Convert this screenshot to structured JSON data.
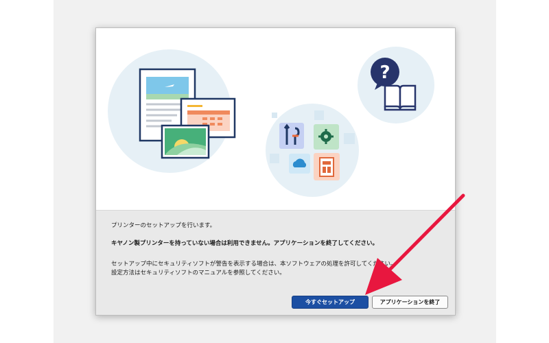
{
  "dialog": {
    "messages": {
      "setup_notice": "プリンターのセットアップを行います。",
      "canon_requirement": "キヤノン製プリンターを持っていない場合は利用できません。アプリケーションを終了してください。",
      "security_line1": "セットアップ中にセキュリティソフトが警告を表示する場合は、本ソフトウェアの処理を許可してください。",
      "security_line2": "設定方法はセキュリティソフトのマニュアルを参照してください。"
    },
    "buttons": {
      "setup_now": "今すぐセットアップ",
      "exit_app": "アプリケーションを終了"
    },
    "illustrations": [
      "document-photo-icon",
      "tools-icon",
      "gear-icon",
      "cloud-icon",
      "layout-icon",
      "help-question-icon",
      "book-icon"
    ],
    "colors": {
      "primary_button": "#1c4fa3",
      "arrow": "#e8173f",
      "circle": "#e6f0f6"
    }
  }
}
